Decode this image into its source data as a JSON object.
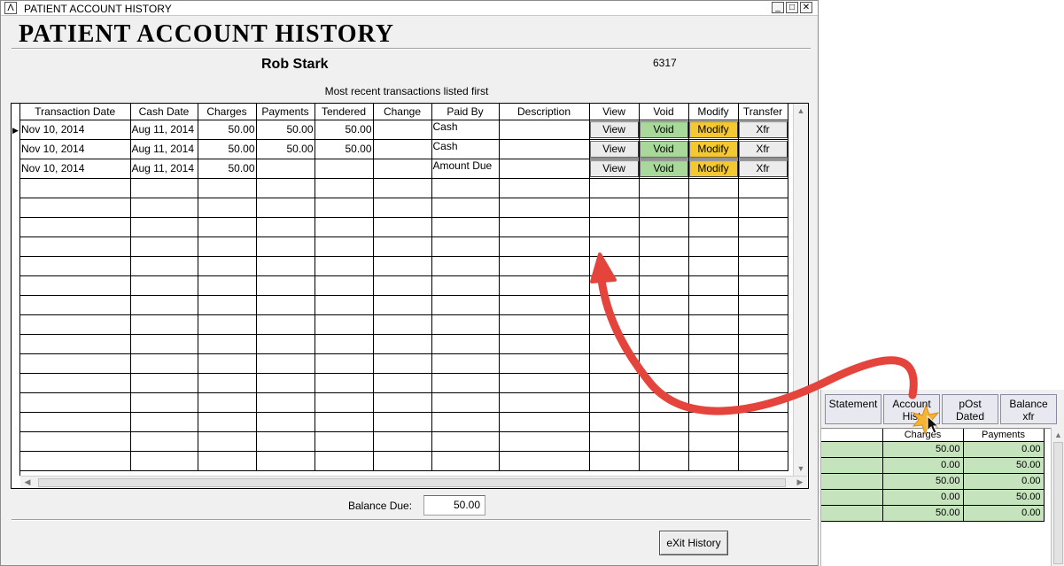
{
  "window": {
    "title": "PATIENT ACCOUNT HISTORY",
    "controls": {
      "minimize": "_",
      "maximize": "□",
      "close": "✕"
    }
  },
  "heading": "PATIENT ACCOUNT HISTORY",
  "patient": {
    "name": "Rob Stark",
    "id": "6317"
  },
  "note": "Most recent transactions listed first",
  "table": {
    "columns": [
      "Transaction Date",
      "Cash Date",
      "Charges",
      "Payments",
      "Tendered",
      "Change",
      "Paid By",
      "Description",
      "View",
      "Void",
      "Modify",
      "Transfer"
    ],
    "rows": [
      {
        "transaction_date": "Nov 10, 2014",
        "cash_date": "Aug 11, 2014",
        "charges": "50.00",
        "payments": "50.00",
        "tendered": "50.00",
        "change": "",
        "paid_by": "Cash",
        "description": "",
        "view": "View",
        "void": "Void",
        "modify": "Modify",
        "transfer": "Xfr"
      },
      {
        "transaction_date": "Nov 10, 2014",
        "cash_date": "Aug 11, 2014",
        "charges": "50.00",
        "payments": "50.00",
        "tendered": "50.00",
        "change": "",
        "paid_by": "Cash",
        "description": "",
        "view": "View",
        "void": "Void",
        "modify": "Modify",
        "transfer": "Xfr"
      },
      {
        "transaction_date": "Nov 10, 2014",
        "cash_date": "Aug 11, 2014",
        "charges": "50.00",
        "payments": "",
        "tendered": "",
        "change": "",
        "paid_by": "Amount Due",
        "description": "",
        "view": "View",
        "void": "Void",
        "modify": "Modify",
        "transfer": "Xfr"
      }
    ]
  },
  "balance": {
    "label": "Balance Due:",
    "value": "50.00"
  },
  "exit_button": "eXit History",
  "inset": {
    "buttons": [
      {
        "line1": "Statement",
        "line2": ""
      },
      {
        "line1": "Account",
        "line2": "Hist"
      },
      {
        "line1": "pOst",
        "line2": "Dated"
      },
      {
        "line1": "Balance",
        "line2": "xfr"
      }
    ],
    "columns": [
      "",
      "Charges",
      "Payments"
    ],
    "rows": [
      {
        "charges": "50.00",
        "payments": "0.00"
      },
      {
        "charges": "0.00",
        "payments": "50.00"
      },
      {
        "charges": "50.00",
        "payments": "0.00"
      },
      {
        "charges": "0.00",
        "payments": "50.00"
      },
      {
        "charges": "50.00",
        "payments": "0.00"
      }
    ]
  },
  "colors": {
    "void": "#a8d99a",
    "modify": "#f3c830",
    "annotation_arrow": "#e5443c",
    "highlight_green": "#c5e3bc"
  },
  "icons": {
    "app": "app-icon",
    "row_pointer": "triangle-right-icon",
    "cursor": "mouse-pointer-icon",
    "annotation": "curved-arrow-icon"
  }
}
